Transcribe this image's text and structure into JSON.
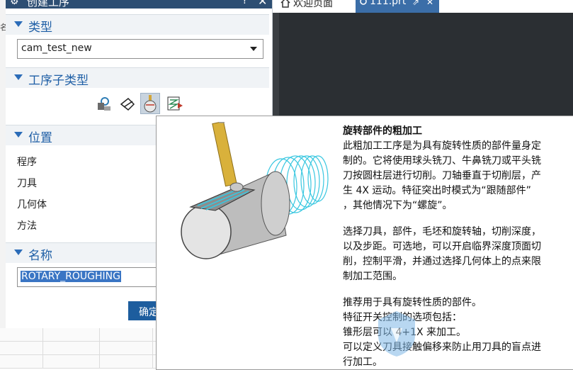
{
  "dialog": {
    "title": "创建工序",
    "help_label": "?",
    "close_label": "✕",
    "sections": {
      "type": {
        "label": "类型",
        "selected_value": "cam_test_new"
      },
      "subtype": {
        "label": "工序子类型",
        "icons": [
          {
            "name": "spindle-tool-icon",
            "selected": false
          },
          {
            "name": "drill-hand-icon",
            "selected": false
          },
          {
            "name": "rotary-roughing-icon",
            "selected": true
          },
          {
            "name": "tool-path-icon",
            "selected": false
          }
        ]
      },
      "position": {
        "label": "位置",
        "fields": [
          "程序",
          "刀具",
          "几何体",
          "方法"
        ]
      },
      "name": {
        "label": "名称",
        "value": "ROTARY_ROUGHING"
      }
    },
    "ok_label": "确定"
  },
  "tabs": [
    {
      "label": "欢迎页面",
      "icon": "home-icon"
    },
    {
      "label": "111.prt",
      "icon": "link-icon",
      "close": "✕"
    }
  ],
  "left_strip_mark": "名",
  "tooltip": {
    "title": "旋转部件的粗加工",
    "paragraph1": [
      "此粗加工工序是为具有旋转性质的部件量身定",
      "制的。它将使用球头铣刀、牛鼻铣刀或平头铣",
      "刀按圆柱层进行切削。刀轴垂直于切削层，产",
      "生 4X 运动。特征突出时模式为“跟随部件”",
      "，其他情况下为“螺旋”。"
    ],
    "paragraph2": [
      "选择刀具，部件，毛坯和旋转轴，切削深度，",
      "以及步距。可选地，可以开启临界深度顶面切",
      "削，控制平滑，并通过选择几何体上的点来限",
      "制加工范围。"
    ],
    "paragraph3": [
      "推荐用于具有旋转性质的部件。",
      "特征开关控制的选项包括：",
      "锥形层可以 4+1X 来加工。",
      "可以定义刀具接触偏移来防止用刀具的盲点进",
      "行加工。"
    ]
  },
  "colors": {
    "title_bar": "#2d4e73",
    "section_label": "#1f5fa6",
    "ok_button": "#1d5d9e",
    "selection": "#3a75c4",
    "workspace": "#2b2f33",
    "active_tab": "#3b6ea8"
  }
}
